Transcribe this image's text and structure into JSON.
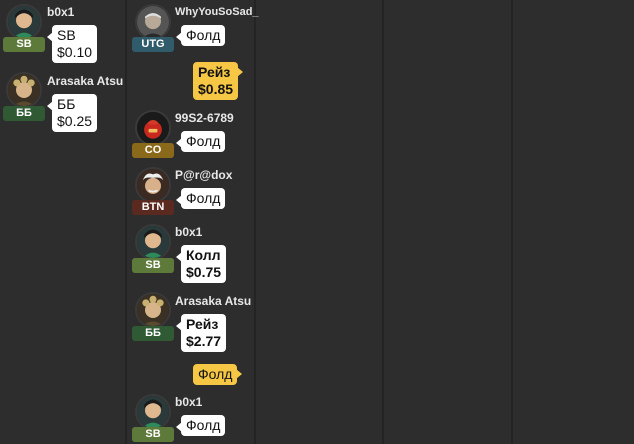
{
  "colors": {
    "background": "#2d2d2d",
    "divider": "#242424",
    "badge_sb": "#5d7a3a",
    "badge_bb": "#2f5a34",
    "badge_utg": "#2f5b6a",
    "badge_co": "#8a6a1a",
    "badge_btn": "#5a2a20",
    "hero_bubble": "#f6c744"
  },
  "columns": [
    {
      "entries": [
        {
          "name": "b0x1",
          "position": "SB",
          "avatar": "woman-green-icon",
          "action": [
            "SB",
            "$0.10"
          ]
        },
        {
          "name": "Arasaka Atsu",
          "position": "ББ",
          "avatar": "samurai-icon",
          "action": [
            "ББ",
            "$0.25"
          ]
        }
      ]
    },
    {
      "entries": [
        {
          "name": "WhyYouSoSad_",
          "position": "UTG",
          "avatar": "old-man-icon",
          "action": [
            "Фолд"
          ]
        },
        {
          "hero_action": [
            "Рейз",
            "$0.85"
          ]
        },
        {
          "name": "99S2-6789",
          "position": "CO",
          "avatar": "red-bag-icon",
          "action": [
            "Фолд"
          ]
        },
        {
          "name": "P@r@dox",
          "position": "BTN",
          "avatar": "einstein-icon",
          "action": [
            "Фолд"
          ]
        },
        {
          "name": "b0x1",
          "position": "SB",
          "avatar": "woman-green-icon",
          "action": [
            "Колл",
            "$0.75"
          ]
        },
        {
          "name": "Arasaka Atsu",
          "position": "ББ",
          "avatar": "samurai-icon",
          "action": [
            "Рейз",
            "$2.77"
          ]
        },
        {
          "hero_action": [
            "Фолд"
          ]
        },
        {
          "name": "b0x1",
          "position": "SB",
          "avatar": "woman-green-icon",
          "action": [
            "Фолд"
          ]
        }
      ]
    }
  ]
}
